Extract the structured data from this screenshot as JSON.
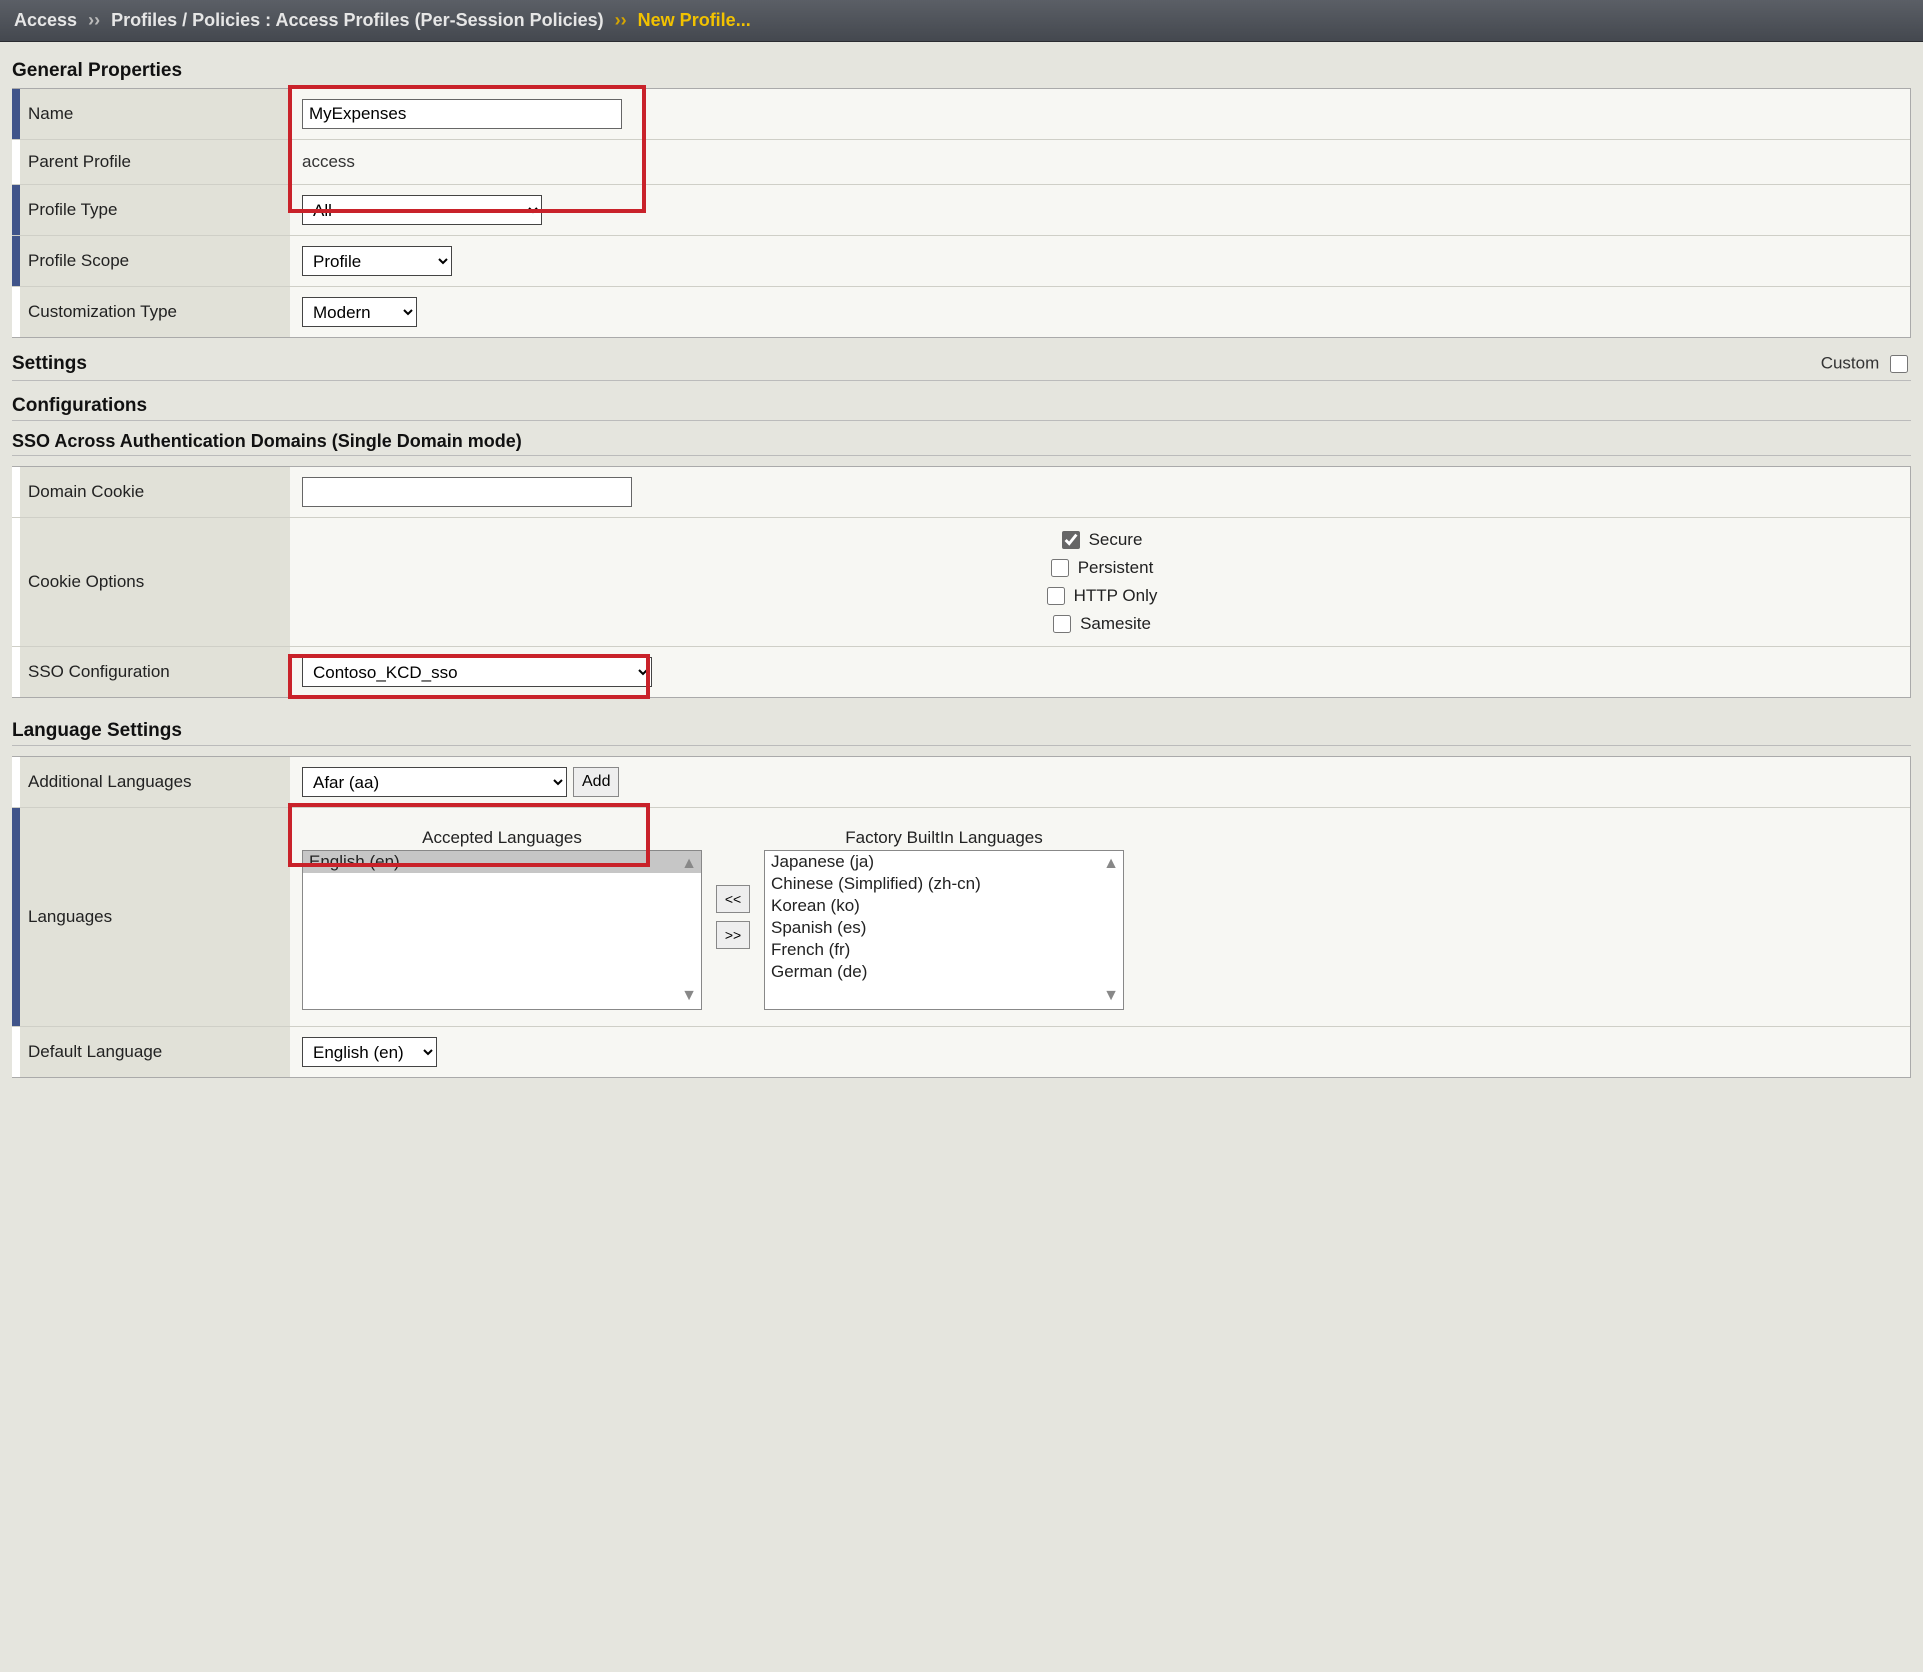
{
  "breadcrumb": {
    "item1": "Access",
    "sep1": "››",
    "item2": "Profiles / Policies : Access Profiles (Per-Session Policies)",
    "sep2": "››",
    "current": "New Profile..."
  },
  "sections": {
    "general_properties": "General Properties",
    "settings": "Settings",
    "custom_label": "Custom",
    "configurations": "Configurations",
    "sso_across": "SSO Across Authentication Domains (Single Domain mode)",
    "language_settings": "Language Settings"
  },
  "general": {
    "name_label": "Name",
    "name_value": "MyExpenses",
    "parent_label": "Parent Profile",
    "parent_value": "access",
    "profile_type_label": "Profile Type",
    "profile_type_value": "All",
    "profile_scope_label": "Profile Scope",
    "profile_scope_value": "Profile",
    "customization_type_label": "Customization Type",
    "customization_type_value": "Modern"
  },
  "sso": {
    "domain_cookie_label": "Domain Cookie",
    "domain_cookie_value": "",
    "cookie_options_label": "Cookie Options",
    "cookie_secure": "Secure",
    "cookie_persistent": "Persistent",
    "cookie_httponly": "HTTP Only",
    "cookie_samesite": "Samesite",
    "sso_config_label": "SSO Configuration",
    "sso_config_value": "Contoso_KCD_sso"
  },
  "lang": {
    "additional_label": "Additional Languages",
    "additional_value": "Afar (aa)",
    "add_button": "Add",
    "languages_label": "Languages",
    "accepted_title": "Accepted Languages",
    "accepted_items": [
      "English (en)"
    ],
    "factory_title": "Factory BuiltIn Languages",
    "factory_items": [
      "Japanese (ja)",
      "Chinese (Simplified) (zh-cn)",
      "Korean (ko)",
      "Spanish (es)",
      "French (fr)",
      "German (de)"
    ],
    "move_left": "<<",
    "move_right": ">>",
    "default_label": "Default Language",
    "default_value": "English (en)"
  }
}
